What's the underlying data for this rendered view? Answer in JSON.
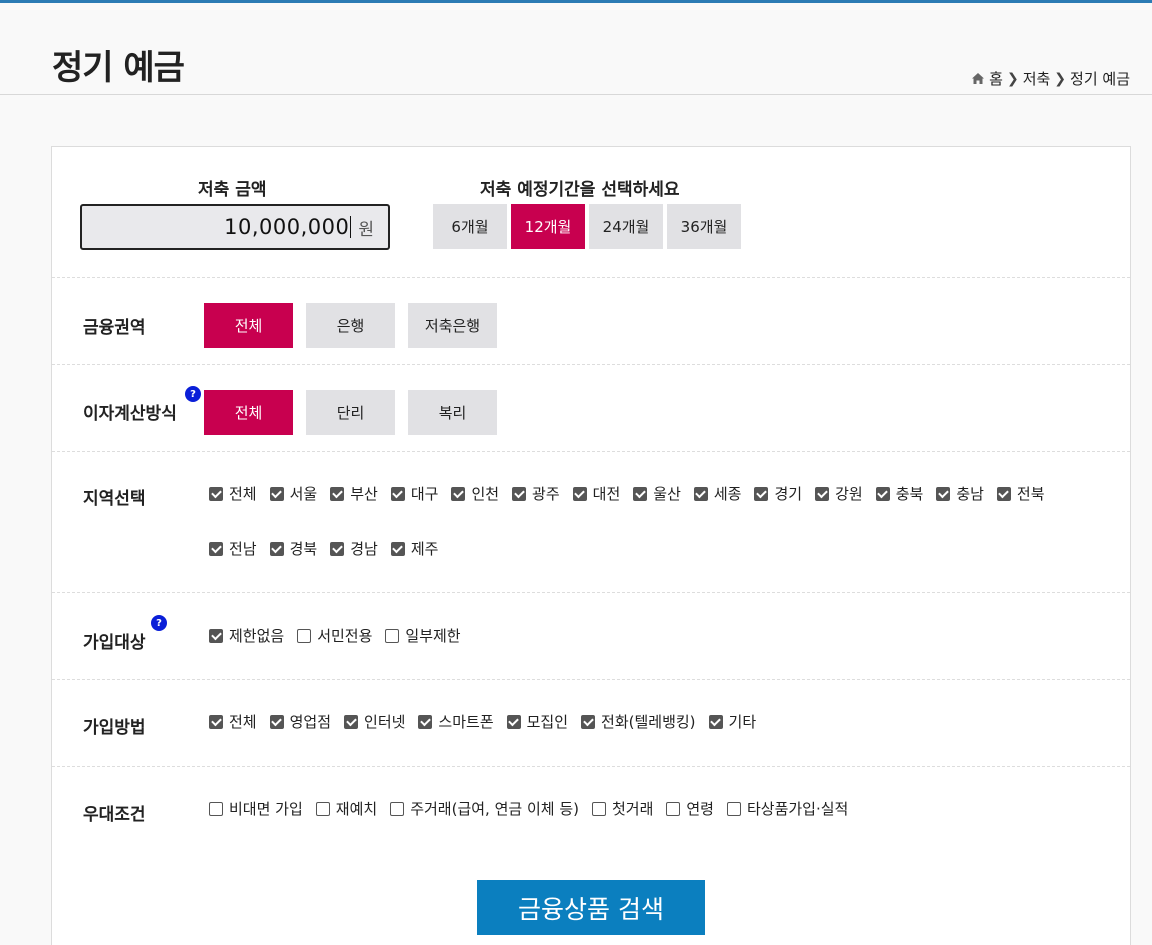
{
  "page": {
    "title": "정기 예금"
  },
  "breadcrumb": {
    "home_icon": "home-icon",
    "items": [
      "홈",
      "저축",
      "정기 예금"
    ]
  },
  "amount": {
    "label": "저축 금액",
    "value": "10,000,000",
    "unit": "원"
  },
  "period": {
    "label": "저축 예정기간을 선택하세요",
    "options": [
      {
        "label": "6개월",
        "selected": false
      },
      {
        "label": "12개월",
        "selected": true
      },
      {
        "label": "24개월",
        "selected": false
      },
      {
        "label": "36개월",
        "selected": false
      }
    ]
  },
  "sector": {
    "label": "금융권역",
    "options": [
      {
        "label": "전체",
        "selected": true
      },
      {
        "label": "은행",
        "selected": false
      },
      {
        "label": "저축은행",
        "selected": false
      }
    ]
  },
  "interest": {
    "label": "이자계산방식",
    "help": "?",
    "options": [
      {
        "label": "전체",
        "selected": true
      },
      {
        "label": "단리",
        "selected": false
      },
      {
        "label": "복리",
        "selected": false
      }
    ]
  },
  "region": {
    "label": "지역선택",
    "row1": [
      {
        "label": "전체",
        "checked": true
      },
      {
        "label": "서울",
        "checked": true
      },
      {
        "label": "부산",
        "checked": true
      },
      {
        "label": "대구",
        "checked": true
      },
      {
        "label": "인천",
        "checked": true
      },
      {
        "label": "광주",
        "checked": true
      },
      {
        "label": "대전",
        "checked": true
      },
      {
        "label": "울산",
        "checked": true
      },
      {
        "label": "세종",
        "checked": true
      },
      {
        "label": "경기",
        "checked": true
      },
      {
        "label": "강원",
        "checked": true
      },
      {
        "label": "충북",
        "checked": true
      },
      {
        "label": "충남",
        "checked": true
      },
      {
        "label": "전북",
        "checked": true
      }
    ],
    "row2": [
      {
        "label": "전남",
        "checked": true
      },
      {
        "label": "경북",
        "checked": true
      },
      {
        "label": "경남",
        "checked": true
      },
      {
        "label": "제주",
        "checked": true
      }
    ]
  },
  "target": {
    "label": "가입대상",
    "help": "?",
    "options": [
      {
        "label": "제한없음",
        "checked": true
      },
      {
        "label": "서민전용",
        "checked": false
      },
      {
        "label": "일부제한",
        "checked": false
      }
    ]
  },
  "method": {
    "label": "가입방법",
    "options": [
      {
        "label": "전체",
        "checked": true
      },
      {
        "label": "영업점",
        "checked": true
      },
      {
        "label": "인터넷",
        "checked": true
      },
      {
        "label": "스마트폰",
        "checked": true
      },
      {
        "label": "모집인",
        "checked": true
      },
      {
        "label": "전화(텔레뱅킹)",
        "checked": true
      },
      {
        "label": "기타",
        "checked": true
      }
    ]
  },
  "benefit": {
    "label": "우대조건",
    "options": [
      {
        "label": "비대면 가입",
        "checked": false
      },
      {
        "label": "재예치",
        "checked": false
      },
      {
        "label": "주거래(급여, 연금 이체 등)",
        "checked": false
      },
      {
        "label": "첫거래",
        "checked": false
      },
      {
        "label": "연령",
        "checked": false
      },
      {
        "label": "타상품가입·실적",
        "checked": false
      }
    ]
  },
  "search": {
    "label": "금융상품 검색"
  },
  "colors": {
    "accent": "#c8004f",
    "primary": "#0b7fbf",
    "help_badge": "#0a1fd8"
  }
}
